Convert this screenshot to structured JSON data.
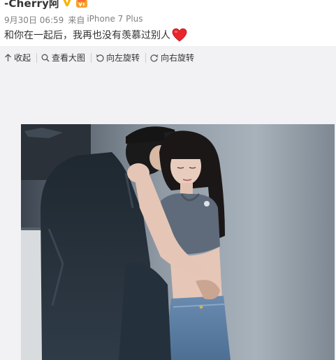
{
  "post": {
    "username": "-Cherry阿",
    "date": "9月30日 06:59",
    "source_prefix": "来自",
    "source": "iPhone 7 Plus",
    "text": "和你在一起后，我再也没有羡慕过别人"
  },
  "toolbar": {
    "collapse_label": "收起",
    "view_large_label": "查看大图",
    "rotate_left_label": "向左旋转",
    "rotate_right_label": "向右旋转"
  },
  "icons": {
    "verified": "verified-v-icon",
    "vip": "vip-badge-icon",
    "heart": "red-heart-emoji-icon",
    "collapse": "arrow-up-icon",
    "view_large": "magnifier-icon",
    "rotate_left": "rotate-left-icon",
    "rotate_right": "rotate-right-icon"
  },
  "colors": {
    "verified": "#f7b500",
    "heart": "#e8262c",
    "toolbar_bg": "#f2f2f5",
    "meta_text": "#808080"
  }
}
